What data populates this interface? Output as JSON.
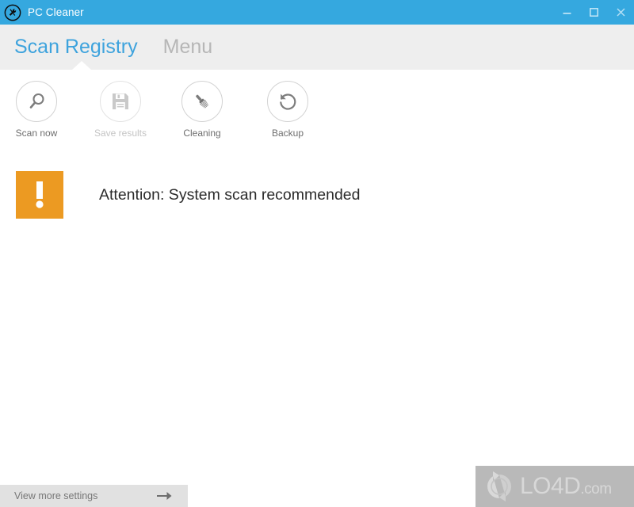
{
  "window": {
    "title": "PC Cleaner",
    "app_icon": "wrench-circle-icon",
    "controls": {
      "minimize": "minimize-icon",
      "maximize": "maximize-icon",
      "close": "close-icon"
    },
    "titlebar_color": "#35a8df"
  },
  "tabs": [
    {
      "label": "Scan Registry",
      "active": true,
      "color": "#3ea3dd"
    },
    {
      "label": "Menu",
      "active": false,
      "color": "#b6b6b6"
    }
  ],
  "toolbar": {
    "items": [
      {
        "label": "Scan now",
        "icon": "magnifier-icon",
        "enabled": true
      },
      {
        "label": "Save results",
        "icon": "floppy-disk-icon",
        "enabled": false
      },
      {
        "label": "Cleaning",
        "icon": "brush-icon",
        "enabled": true
      },
      {
        "label": "Backup",
        "icon": "restore-clock-icon",
        "enabled": true
      }
    ]
  },
  "notice": {
    "icon": "exclamation-icon",
    "message": "Attention: System scan recommended",
    "badge_color": "#ec9a22"
  },
  "footer": {
    "settings_label": "View more settings",
    "arrow_icon": "arrow-right-icon"
  },
  "watermark": {
    "logo": "recycle-arrows-icon",
    "name": "LO4D",
    "suffix": ".com"
  }
}
